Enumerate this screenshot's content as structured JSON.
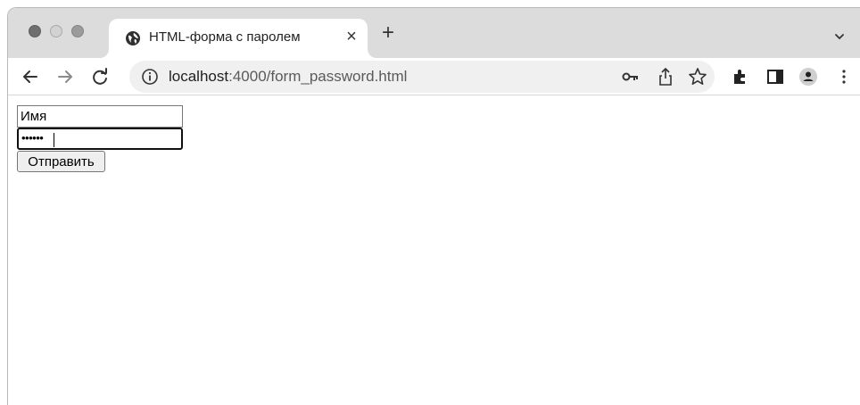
{
  "tab": {
    "title": "HTML-форма с паролем",
    "close_glyph": "×",
    "new_tab_glyph": "+"
  },
  "address_bar": {
    "host": "localhost",
    "path": ":4000/form_password.html"
  },
  "form": {
    "name_placeholder": "Имя",
    "password_dots": "••••••",
    "submit_label": "Отправить"
  },
  "icons": [
    "traffic-light-close-icon",
    "traffic-light-minimize-icon",
    "traffic-light-maximize-icon",
    "globe-icon",
    "close-icon",
    "plus-icon",
    "chevron-down-icon",
    "back-arrow-icon",
    "forward-arrow-icon",
    "reload-icon",
    "info-icon",
    "key-icon",
    "share-icon",
    "star-icon",
    "extensions-puzzle-icon",
    "side-panel-icon",
    "profile-avatar-icon",
    "more-menu-icon"
  ]
}
